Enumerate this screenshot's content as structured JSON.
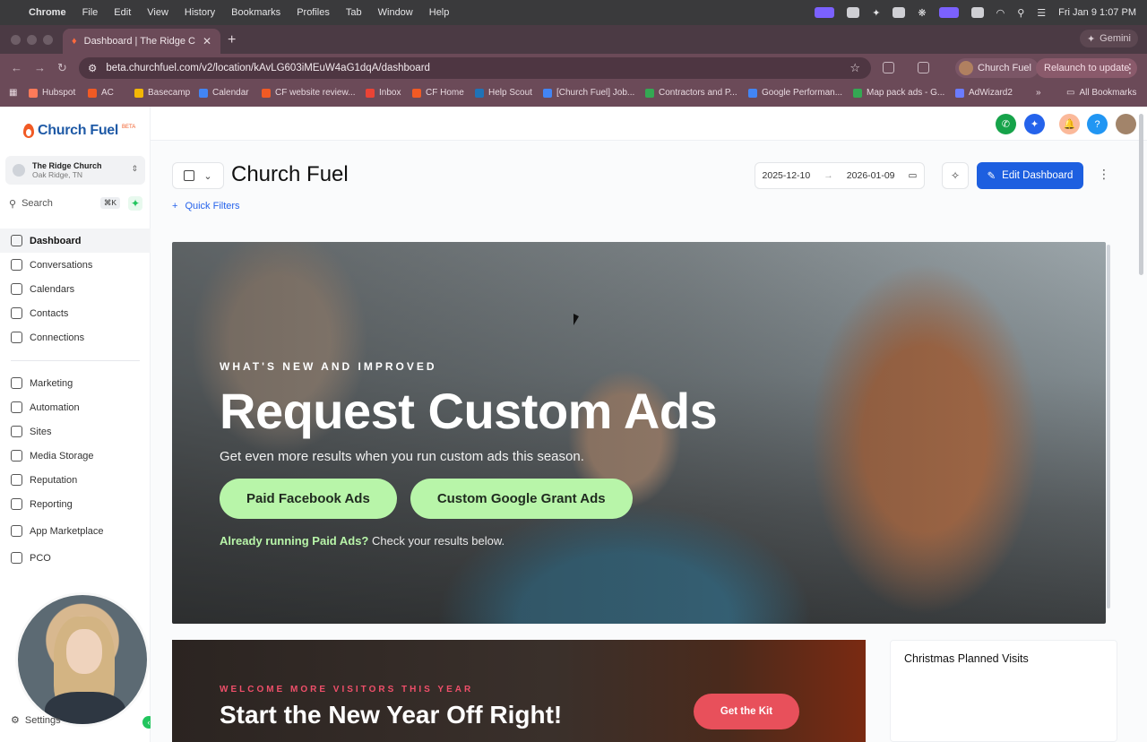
{
  "menubar": {
    "app": "Chrome",
    "items": [
      "File",
      "Edit",
      "View",
      "History",
      "Bookmarks",
      "Profiles",
      "Tab",
      "Window",
      "Help"
    ],
    "clock": "Fri Jan 9  1:07 PM"
  },
  "browser": {
    "tab_title": "Dashboard | The Ridge Churc",
    "gemini": "Gemini",
    "url": "beta.churchfuel.com/v2/location/kAvLG603iMEuW4aG1dqA/dashboard",
    "profile": "Church Fuel",
    "relaunch": "Relaunch to update",
    "bookmarks": [
      {
        "label": "Hubspot",
        "color": "#ff7a59"
      },
      {
        "label": "AC",
        "color": "#f15a24"
      },
      {
        "label": "Basecamp",
        "color": "#f2b705"
      },
      {
        "label": "Calendar",
        "color": "#4285f4"
      },
      {
        "label": "CF website review...",
        "color": "#f15a24"
      },
      {
        "label": "Inbox",
        "color": "#ea4335"
      },
      {
        "label": "CF Home",
        "color": "#f15a24"
      },
      {
        "label": "Help Scout",
        "color": "#1f73b7"
      },
      {
        "label": "[Church Fuel] Job...",
        "color": "#4285f4"
      },
      {
        "label": "Contractors and P...",
        "color": "#34a853"
      },
      {
        "label": "Google Performan...",
        "color": "#4285f4"
      },
      {
        "label": "Map pack ads - G...",
        "color": "#34a853"
      },
      {
        "label": "AdWizard2",
        "color": "#6b7cff"
      }
    ],
    "all_bookmarks": "All Bookmarks"
  },
  "sidebar": {
    "brand": "Church Fuel",
    "brand_badge": "BETA",
    "location_name": "The Ridge Church",
    "location_city": "Oak Ridge, TN",
    "search_placeholder": "Search",
    "search_shortcut": "⌘K",
    "nav": [
      {
        "label": "Dashboard",
        "icon": "grid-icon"
      },
      {
        "label": "Conversations",
        "icon": "chat-icon"
      },
      {
        "label": "Calendars",
        "icon": "calendar-icon"
      },
      {
        "label": "Contacts",
        "icon": "contacts-icon"
      },
      {
        "label": "Connections",
        "icon": "network-icon"
      },
      {
        "label": "Marketing",
        "icon": "send-icon"
      },
      {
        "label": "Automation",
        "icon": "automation-icon"
      },
      {
        "label": "Sites",
        "icon": "globe-icon"
      },
      {
        "label": "Media Storage",
        "icon": "image-icon"
      },
      {
        "label": "Reputation",
        "icon": "star-icon"
      },
      {
        "label": "Reporting",
        "icon": "chart-icon"
      },
      {
        "label": "App Marketplace",
        "icon": "apps-icon"
      },
      {
        "label": "PCO",
        "icon": "pco-icon"
      }
    ],
    "settings": "Settings"
  },
  "header": {
    "title": "Church Fuel",
    "quick_filters": "Quick Filters",
    "date_start": "2025-12-10",
    "date_end": "2026-01-09",
    "edit_label": "Edit Dashboard"
  },
  "hero": {
    "eyebrow": "WHAT'S NEW AND IMPROVED",
    "title": "Request Custom Ads",
    "subtitle": "Get even more results when you run custom ads this season.",
    "btn1": "Paid Facebook Ads",
    "btn2": "Custom Google Grant Ads",
    "note_bold": "Already running Paid Ads?",
    "note_rest": " Check your results below."
  },
  "banner2": {
    "eyebrow": "WELCOME MORE VISITORS THIS YEAR",
    "title": "Start the New Year Off Right!",
    "cta": "Get the Kit"
  },
  "widget": {
    "title": "Christmas Planned Visits"
  }
}
